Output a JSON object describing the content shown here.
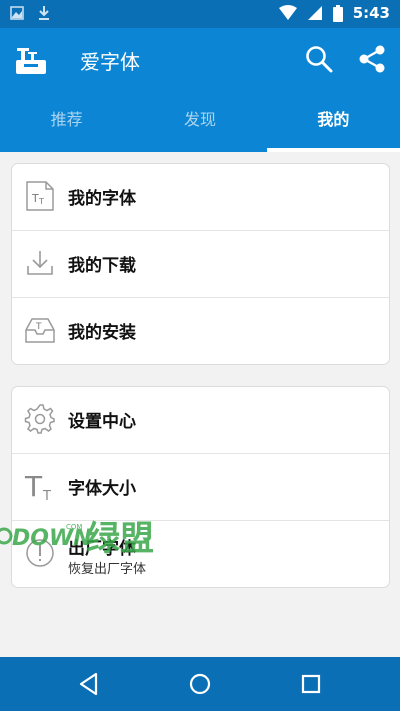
{
  "status": {
    "time": "5:43"
  },
  "app": {
    "title": "爱字体"
  },
  "tabs": [
    "推荐",
    "发现",
    "我的"
  ],
  "active_tab": "我的",
  "section1": [
    {
      "label": "我的字体",
      "icon": "font-file-icon"
    },
    {
      "label": "我的下载",
      "icon": "download-icon"
    },
    {
      "label": "我的安装",
      "icon": "install-tray-icon"
    }
  ],
  "section2": [
    {
      "label": "设置中心",
      "icon": "gear-icon"
    },
    {
      "label": "字体大小",
      "icon": "font-size-icon"
    },
    {
      "label": "出厂字体",
      "sublabel": "恢复出厂字体",
      "icon": "info-icon"
    }
  ],
  "watermark": {
    "text": "DOWN",
    "small": "COM",
    "brand": "绿盟"
  },
  "colors": {
    "primary": "#0b85d4",
    "status_bar": "#0b6fb6",
    "watermark": "#3aa84b"
  }
}
